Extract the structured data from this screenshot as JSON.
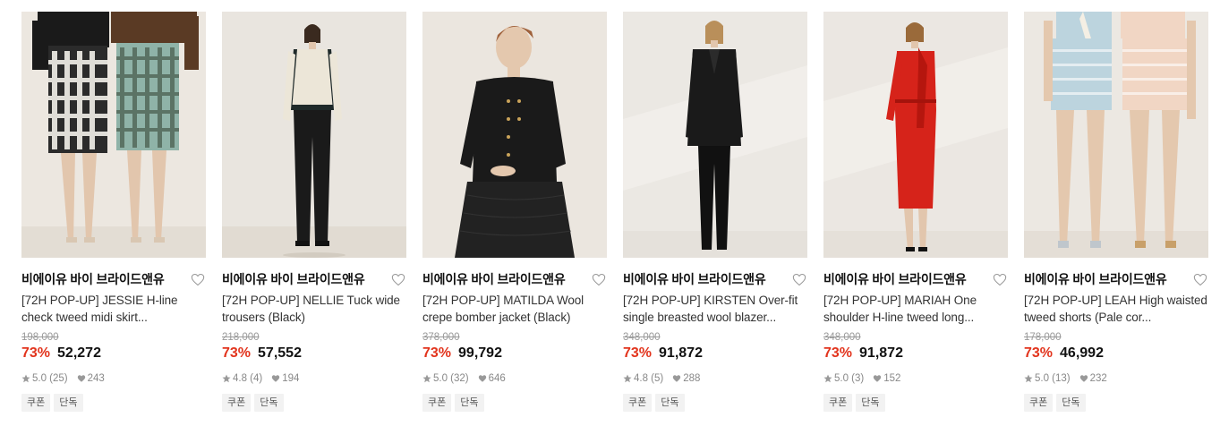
{
  "products": [
    {
      "brand": "비에이유 바이 브라이드앤유",
      "title": "[72H POP-UP] JESSIE H-line check tweed midi skirt...",
      "original_price": "198,000",
      "discount": "73%",
      "price": "52,272",
      "rating": "5.0 (25)",
      "likes": "243",
      "tags": [
        "쿠폰",
        "단독"
      ],
      "figure": "skirt"
    },
    {
      "brand": "비에이유 바이 브라이드앤유",
      "title": "[72H POP-UP] NELLIE Tuck wide trousers (Black)",
      "original_price": "218,000",
      "discount": "73%",
      "price": "57,552",
      "rating": "4.8 (4)",
      "likes": "194",
      "tags": [
        "쿠폰",
        "단독"
      ],
      "figure": "trousers"
    },
    {
      "brand": "비에이유 바이 브라이드앤유",
      "title": "[72H POP-UP] MATILDA Wool crepe bomber jacket (Black)",
      "original_price": "378,000",
      "discount": "73%",
      "price": "99,792",
      "rating": "5.0 (32)",
      "likes": "646",
      "tags": [
        "쿠폰",
        "단독"
      ],
      "figure": "jacket"
    },
    {
      "brand": "비에이유 바이 브라이드앤유",
      "title": "[72H POP-UP] KIRSTEN Over-fit single breasted wool blazer...",
      "original_price": "348,000",
      "discount": "73%",
      "price": "91,872",
      "rating": "4.8 (5)",
      "likes": "288",
      "tags": [
        "쿠폰",
        "단독"
      ],
      "figure": "suit"
    },
    {
      "brand": "비에이유 바이 브라이드앤유",
      "title": "[72H POP-UP] MARIAH One shoulder H-line tweed long...",
      "original_price": "348,000",
      "discount": "73%",
      "price": "91,872",
      "rating": "5.0 (3)",
      "likes": "152",
      "tags": [
        "쿠폰",
        "단독"
      ],
      "figure": "dress"
    },
    {
      "brand": "비에이유 바이 브라이드앤유",
      "title": "[72H POP-UP] LEAH High waisted tweed shorts (Pale cor...",
      "original_price": "178,000",
      "discount": "73%",
      "price": "46,992",
      "rating": "5.0 (13)",
      "likes": "232",
      "tags": [
        "쿠폰",
        "단독"
      ],
      "figure": "shorts"
    }
  ],
  "colors": {
    "discount": "#e2341d",
    "price": "#111111",
    "original_price": "#999999",
    "tag_bg": "#f2f2f2"
  },
  "icons": {
    "like": "heart-outline-icon",
    "rating": "star-icon",
    "likes": "heart-filled-icon"
  }
}
